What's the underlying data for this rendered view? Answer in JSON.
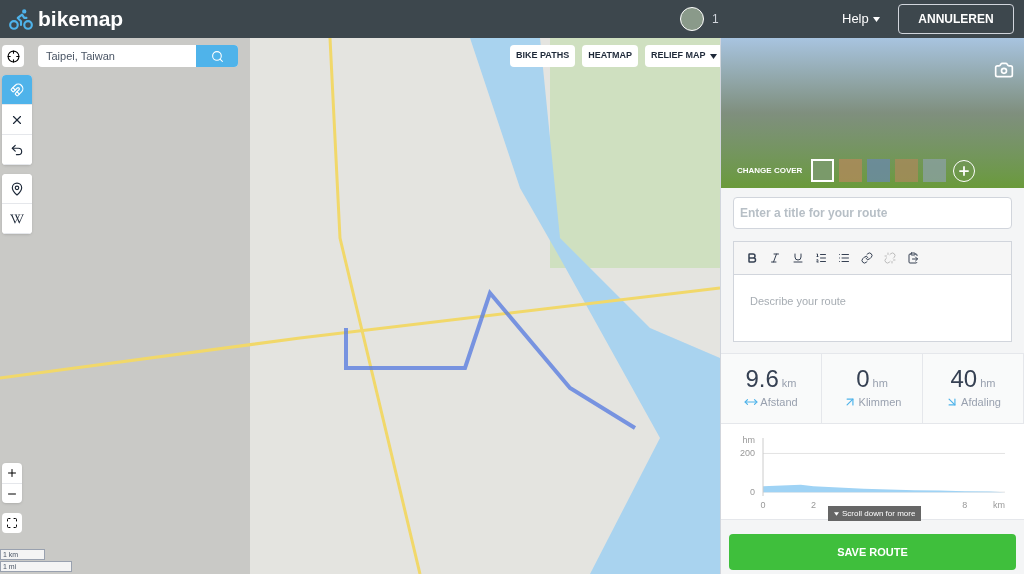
{
  "header": {
    "logo": "bikemap",
    "notifications": "1",
    "help": "Help",
    "cancel": "ANNULEREN"
  },
  "search": {
    "value": "Taipei, Taiwan"
  },
  "map_layers": [
    {
      "label": "BIKE PATHS",
      "dropdown": false
    },
    {
      "label": "HEATMAP",
      "dropdown": false
    },
    {
      "label": "RELIEF MAP",
      "dropdown": true
    }
  ],
  "tool_groups": [
    [
      {
        "kind": "magnet",
        "on": true
      },
      {
        "kind": "clear",
        "on": false
      },
      {
        "kind": "undo",
        "on": false
      }
    ],
    [
      {
        "kind": "pin",
        "on": false
      },
      {
        "kind": "wiki",
        "on": false
      }
    ]
  ],
  "scale": [
    "1 km",
    "1 mi"
  ],
  "cover": {
    "label": "CHANGE COVER",
    "thumbnails": [
      {
        "selected": true
      },
      {
        "selected": false
      },
      {
        "selected": false
      },
      {
        "selected": false
      },
      {
        "selected": false
      }
    ]
  },
  "title_field": {
    "placeholder": "Enter a title for your route"
  },
  "editor": {
    "placeholder": "Describe your route"
  },
  "stats": [
    {
      "kind": "distance",
      "value": "9.6",
      "unit": "km",
      "label": "Afstand"
    },
    {
      "kind": "climb",
      "value": "0",
      "unit": "hm",
      "label": "Klimmen"
    },
    {
      "kind": "descent",
      "value": "40",
      "unit": "hm",
      "label": "Afdaling"
    }
  ],
  "elevation": {
    "scroll_hint": "Scroll down for more",
    "chart_data": {
      "type": "area",
      "ylabel": "hm",
      "xlabel": "km",
      "x": [
        0,
        1,
        1.5,
        2,
        3,
        4,
        5,
        6,
        7,
        8,
        9,
        9.6
      ],
      "series": [
        {
          "color": "#9fd3f5",
          "values": [
            30,
            35,
            38,
            30,
            24,
            18,
            14,
            10,
            8,
            5,
            3,
            0
          ]
        }
      ],
      "xlim": [
        0,
        9.6
      ],
      "ylim": [
        -20,
        280
      ],
      "xticks": [
        0,
        2,
        8
      ],
      "yticks": [
        0,
        200
      ]
    }
  },
  "save": "SAVE ROUTE"
}
